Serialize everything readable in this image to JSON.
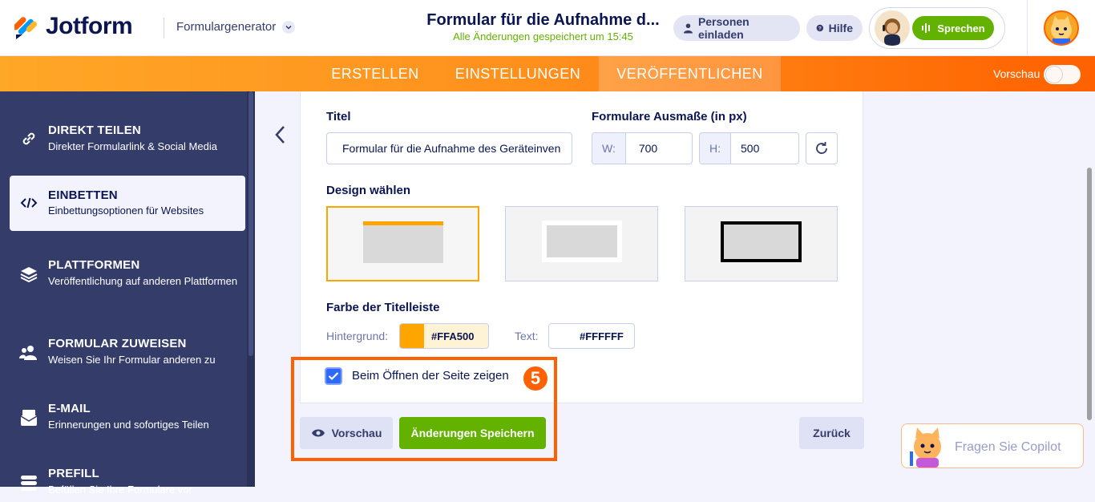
{
  "header": {
    "brand": "Jotform",
    "builder_label": "Formulargenerator",
    "form_title": "Formular für die Aufnahme d...",
    "saved_status": "Alle Änderungen gespeichert um 15:45",
    "invite_label": "Personen einladen",
    "help_label": "Hilfe",
    "speak_label": "Sprechen"
  },
  "tabs": [
    {
      "label": "ERSTELLEN",
      "active": false
    },
    {
      "label": "EINSTELLUNGEN",
      "active": false
    },
    {
      "label": "VERÖFFENTLICHEN",
      "active": true
    }
  ],
  "preview_toggle_label": "Vorschau",
  "sidebar": {
    "items": [
      {
        "title": "DIREKT TEILEN",
        "desc": "Direkter Formularlink & Social Media",
        "icon": "link-icon",
        "active": false
      },
      {
        "title": "EINBETTEN",
        "desc": "Einbettungsoptionen für Websites",
        "icon": "code-icon",
        "active": true
      },
      {
        "title": "PLATTFORMEN",
        "desc": "Veröffentlichung auf anderen Plattformen",
        "icon": "layers-icon",
        "active": false
      },
      {
        "title": "FORMULAR ZUWEISEN",
        "desc": "Weisen Sie Ihr Formular anderen zu",
        "icon": "users-icon",
        "active": false
      },
      {
        "title": "E-MAIL",
        "desc": "Erinnerungen und sofortiges Teilen",
        "icon": "email-icon",
        "active": false
      },
      {
        "title": "PREFILL",
        "desc": "Befüllen Sie Ihre Formulare vor",
        "icon": "prefill-icon",
        "active": false
      }
    ]
  },
  "panel": {
    "title_label": "Titel",
    "title_value": "Formular für die Aufnahme des Geräteinven",
    "size_label": "Formulare Ausmaße (in px)",
    "width_prefix": "W:",
    "width_value": "700",
    "height_prefix": "H:",
    "height_value": "500",
    "design_label": "Design wählen",
    "titlebar_color_label": "Farbe der Titelleiste",
    "bg_label": "Hintergrund:",
    "bg_value": "#FFA500",
    "text_label": "Text:",
    "text_value": "#FFFFFF",
    "show_on_open_label": "Beim Öffnen der Seite zeigen",
    "show_on_open_checked": true,
    "step_number": "5"
  },
  "buttons": {
    "preview": "Vorschau",
    "save": "Änderungen Speichern",
    "back": "Zurück"
  },
  "copilot_label": "Fragen Sie Copilot",
  "colors": {
    "accent_orange": "#ff6100",
    "titlebar_bg": "#FFA500",
    "save_green": "#64b200",
    "sidebar_bg": "#343c6a"
  }
}
